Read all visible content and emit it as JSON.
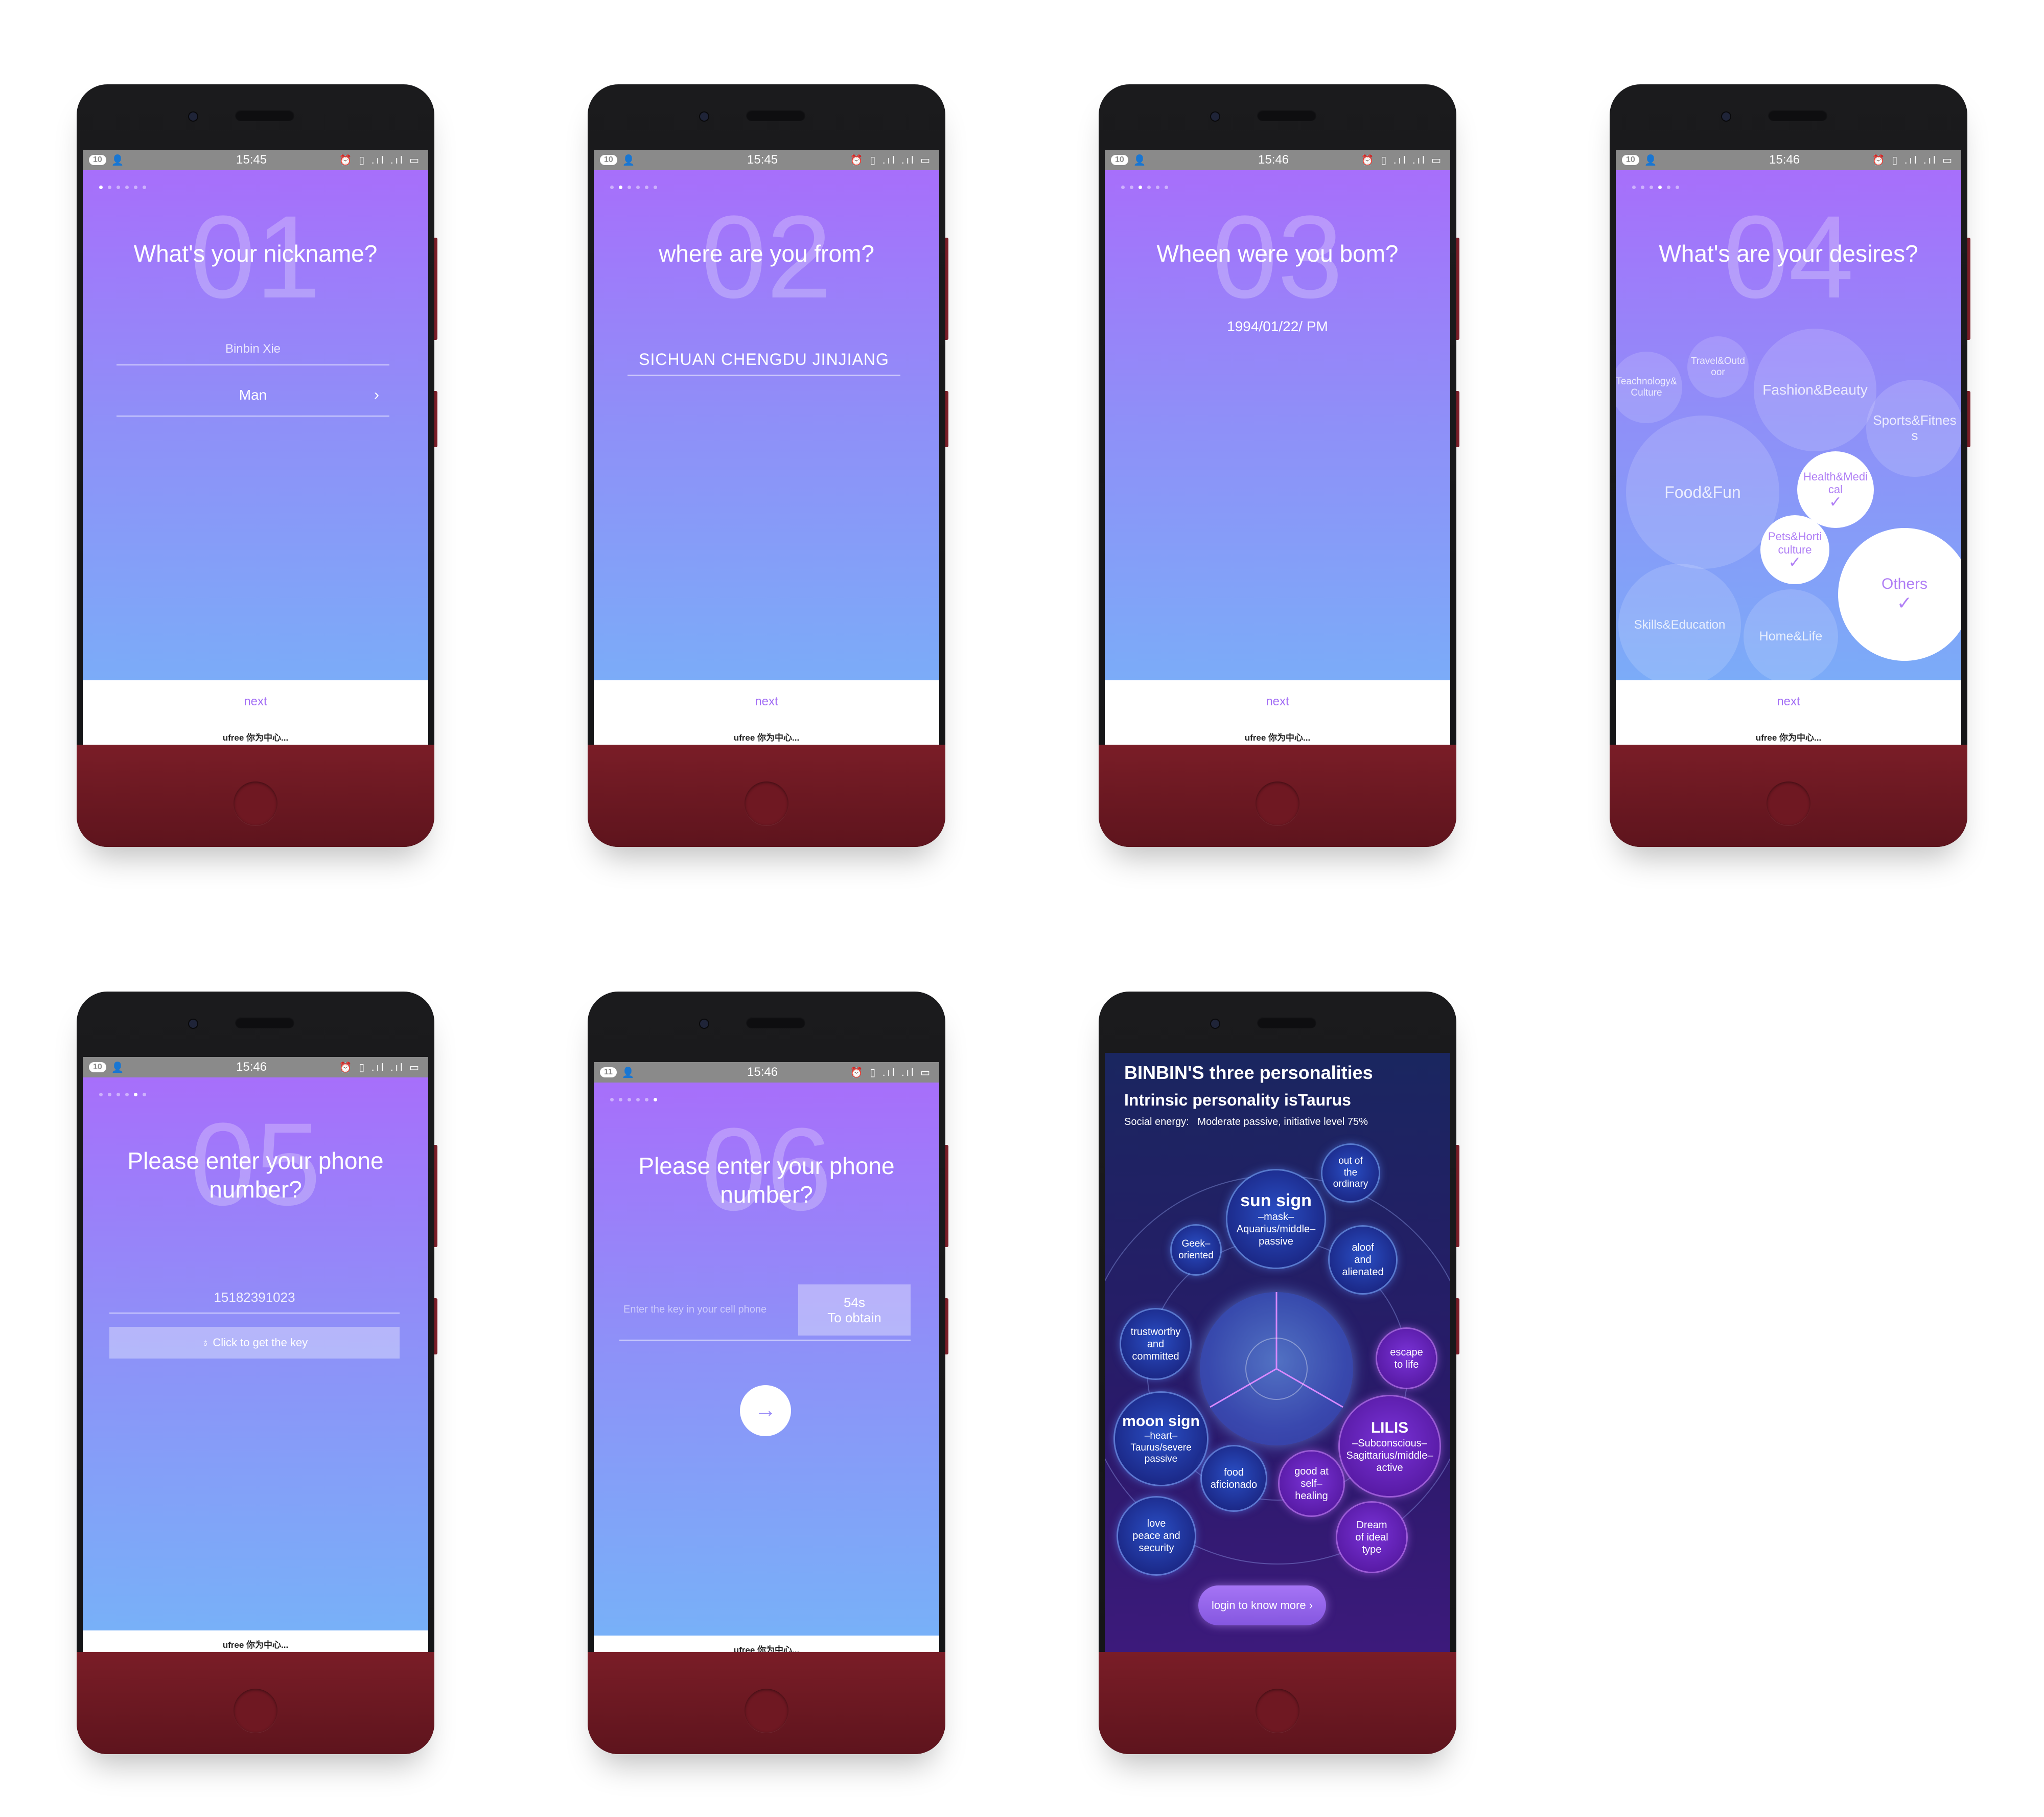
{
  "status": {
    "time_1": "15:45",
    "time_2": "15:45",
    "time_3": "15:46",
    "time_4": "15:46",
    "time_5": "15:46",
    "time_6": "15:46",
    "badge_a": "10",
    "badge_b": "11",
    "battery": "27",
    "icons": "⏰ ▯ .ıl .ıl ▭"
  },
  "brand": "ufree 你为中心...",
  "next_label": "next",
  "screen1": {
    "num": "01",
    "question": "What's your nickname?",
    "nickname": "Binbin Xie",
    "gender": "Man",
    "chevron": "›"
  },
  "screen2": {
    "num": "02",
    "question": "where are you from?",
    "location": "SICHUAN CHENGDU JINJIANG"
  },
  "screen3": {
    "num": "03",
    "question": "Wheen were you bom?",
    "birth": "1994/01/22/ PM"
  },
  "screen4": {
    "num": "04",
    "question": "What's are your desires?",
    "bubbles": [
      {
        "label": "Teachnology&\nCulture",
        "selected": false
      },
      {
        "label": "Travel&Outd\noor",
        "selected": false
      },
      {
        "label": "Fashion&Beauty",
        "selected": false
      },
      {
        "label": "Sports&Fitnes\ns",
        "selected": false
      },
      {
        "label": "Food&Fun",
        "selected": false
      },
      {
        "label": "Health&Medi\ncal",
        "selected": true
      },
      {
        "label": "Pets&Horti\nculture",
        "selected": true
      },
      {
        "label": "Others",
        "selected": true
      },
      {
        "label": "Skills&Education",
        "selected": false
      },
      {
        "label": "Home&Life",
        "selected": false
      }
    ],
    "check": "✓"
  },
  "screen5": {
    "num": "05",
    "question": "Please enter your phone number?",
    "phone": "15182391023",
    "key_button": "♁ Click to get the key"
  },
  "screen6": {
    "num": "06",
    "question": "Please enter your phone number?",
    "placeholder": "Enter the key in your cell phone",
    "countdown": "54s",
    "obtain": "To obtain",
    "arrow": "→"
  },
  "screen7": {
    "title": "BINBIN'S three personalities",
    "subtitle": "Intrinsic personality isTaurus",
    "social": "Social energy:   Moderate passive, initiative level 75%",
    "sun": {
      "title": "sun sign",
      "text": "–mask–\nAquarius/middle–\npassive"
    },
    "moon": {
      "title": "moon sign",
      "text": "–heart–\nTaurus/severe\npassive"
    },
    "lilis": {
      "title": "LILIS",
      "text": "–Subconscious–\nSagittarius/middle–\nactive"
    },
    "traits": [
      "out of\nthe\nordinary",
      "Geek–\noriented",
      "aloof\nand\nalienated",
      "trustworthy\nand\ncommitted",
      "escape\nto life",
      "food\naficionado",
      "good at\nself–\nhealing",
      "love\npeace and\nsecurity",
      "Dream\nof ideal\ntype"
    ],
    "login_button": "login to know more ›"
  }
}
